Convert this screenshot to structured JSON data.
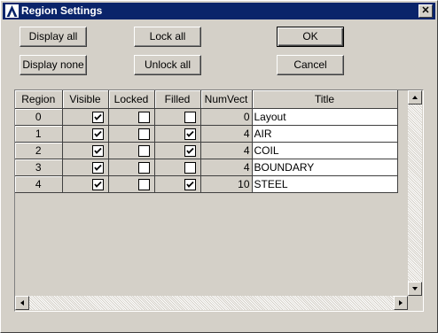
{
  "window": {
    "title": "Region Settings",
    "close_glyph": "✕"
  },
  "buttons": {
    "display_all": "Display all",
    "display_none": "Display none",
    "lock_all": "Lock all",
    "unlock_all": "Unlock all",
    "ok": "OK",
    "cancel": "Cancel"
  },
  "table": {
    "headers": [
      "Region",
      "Visible",
      "Locked",
      "Filled",
      "NumVect",
      "Title"
    ],
    "rows": [
      {
        "region": "0",
        "visible": true,
        "locked": false,
        "filled": false,
        "numvect": "0",
        "title": "Layout"
      },
      {
        "region": "1",
        "visible": true,
        "locked": false,
        "filled": true,
        "numvect": "4",
        "title": "AIR"
      },
      {
        "region": "2",
        "visible": true,
        "locked": false,
        "filled": true,
        "numvect": "4",
        "title": "COIL"
      },
      {
        "region": "3",
        "visible": true,
        "locked": false,
        "filled": false,
        "numvect": "4",
        "title": "BOUNDARY"
      },
      {
        "region": "4",
        "visible": true,
        "locked": false,
        "filled": true,
        "numvect": "10",
        "title": "STEEL"
      }
    ]
  },
  "icons": {
    "app": "app-logo-icon",
    "close": "close-icon"
  },
  "colors": {
    "titlebar": "#0a246a",
    "face": "#d4d0c8"
  }
}
